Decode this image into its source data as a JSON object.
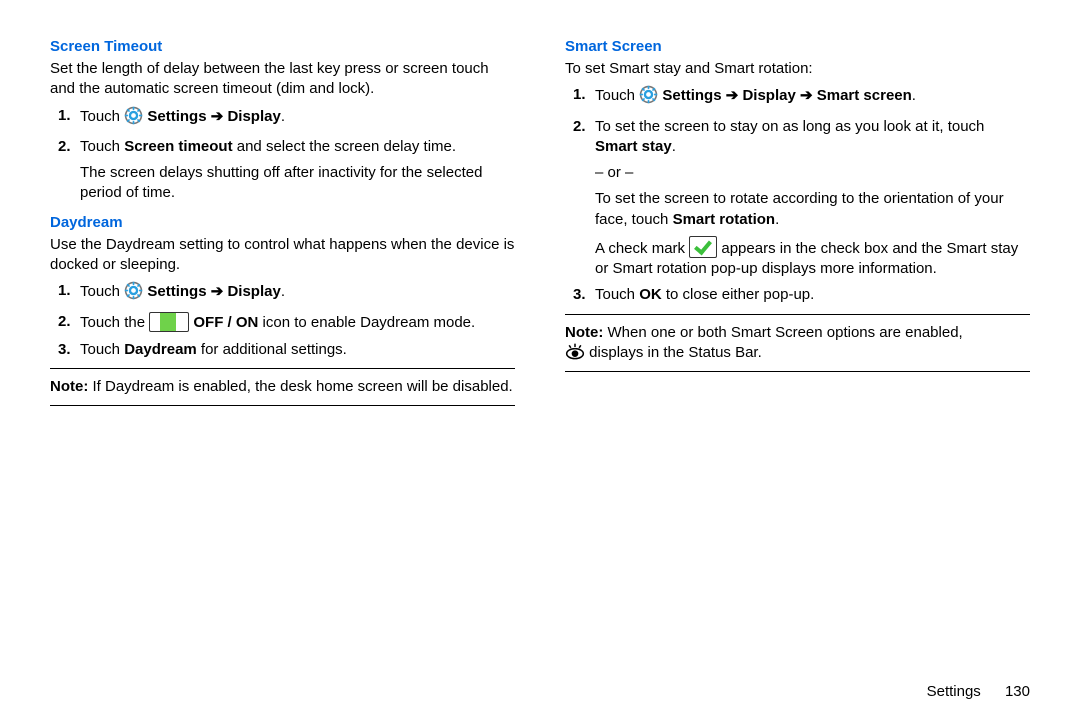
{
  "left": {
    "sec1": {
      "heading": "Screen Timeout",
      "intro": "Set the length of delay between the last key press or screen touch and the automatic screen timeout (dim and lock).",
      "steps": {
        "s1_prefix": "Touch ",
        "s1_settings": "Settings",
        "s1_display": "Display",
        "s1_suffix": ".",
        "s2_a": "Touch ",
        "s2_b": "Screen timeout",
        "s2_c": " and select the screen delay time.",
        "s2_sub": "The screen delays shutting off after inactivity for the selected period of time."
      }
    },
    "sec2": {
      "heading": "Daydream",
      "intro": "Use the Daydream setting to control what happens when the device is docked or sleeping.",
      "steps": {
        "s1_prefix": "Touch ",
        "s1_settings": "Settings",
        "s1_display": "Display",
        "s1_suffix": ".",
        "s2_a": "Touch the ",
        "s2_b": "OFF / ON",
        "s2_c": " icon to enable Daydream mode.",
        "s3_a": "Touch ",
        "s3_b": "Daydream",
        "s3_c": " for additional settings."
      },
      "note_label": "Note:",
      "note_text": " If Daydream is enabled, the desk home screen will be disabled."
    }
  },
  "right": {
    "heading": "Smart Screen",
    "intro": "To set Smart stay and Smart rotation:",
    "steps": {
      "s1_prefix": "Touch ",
      "s1_settings": "Settings",
      "s1_display": "Display",
      "s1_smart": "Smart screen",
      "s1_suffix": ".",
      "s2_a": "To set the screen to stay on as long as you look at it, touch ",
      "s2_b": "Smart stay",
      "s2_c": ".",
      "s2_or": "– or –",
      "s2_d": "To set the screen to rotate according to the orientation of your face, touch ",
      "s2_e": "Smart rotation",
      "s2_f": ".",
      "s2_g1": "A check mark ",
      "s2_g2": " appears in the check box and the Smart stay or Smart rotation pop-up displays more information.",
      "s3_a": "Touch ",
      "s3_b": "OK",
      "s3_c": " to close either pop-up."
    },
    "note_label": "Note:",
    "note_text_a": " When one or both Smart Screen options are enabled, ",
    "note_text_b": " displays in the Status Bar."
  },
  "footer": {
    "section": "Settings",
    "page": "130"
  }
}
